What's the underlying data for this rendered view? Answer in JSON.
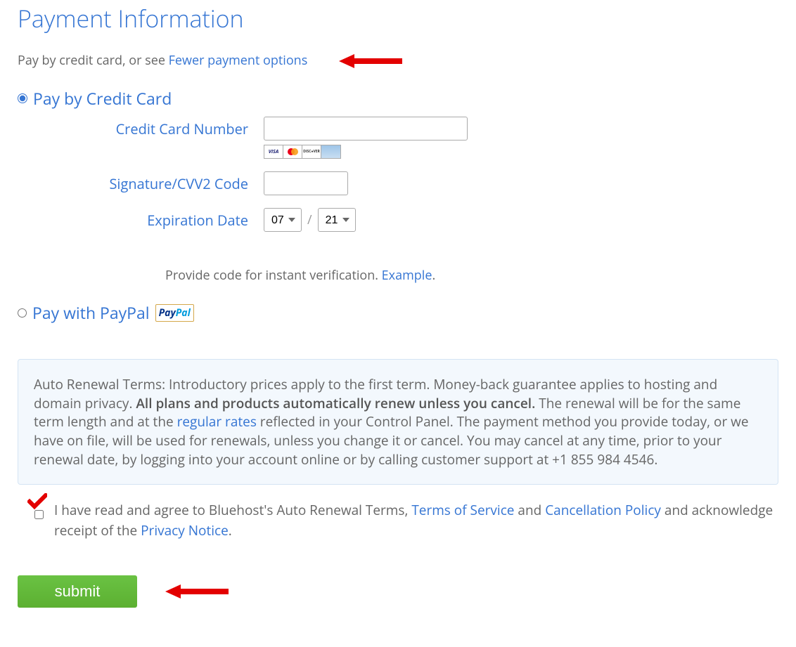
{
  "heading": "Payment Information",
  "intro_prefix": "Pay by credit card, or see ",
  "intro_link": "Fewer payment options",
  "options": {
    "credit": {
      "label": "Pay by Credit Card",
      "cc_label": "Credit Card Number",
      "cvv_label": "Signature/CVV2 Code",
      "exp_label": "Expiration Date",
      "exp_month": "07",
      "exp_year": "21"
    },
    "paypal": {
      "label": "Pay with PayPal"
    }
  },
  "helper_prefix": "Provide code for instant verification. ",
  "helper_link": "Example",
  "helper_suffix": ".",
  "terms": {
    "prefix": "Auto Renewal Terms: Introductory prices apply to the first term. Money-back guarantee applies to hosting and domain privacy. ",
    "bold": "All plans and products automatically renew unless you cancel.",
    "mid1": " The renewal will be for the same term length and at the ",
    "rates_link": "regular rates",
    "mid2": " reflected in your Control Panel. The payment method you provide today, or we have on file, will be used for renewals, unless you change it or cancel. You may cancel at any time, prior to your renewal date, by logging into your account online or by calling customer support at +1 855 984 4546."
  },
  "agree": {
    "prefix": "I have read and agree to Bluehost's Auto Renewal Terms, ",
    "tos": "Terms of Service",
    "and1": " and ",
    "cancel": "Cancellation Policy",
    "mid": " and acknowledge receipt of the ",
    "privacy": "Privacy Notice",
    "suffix": "."
  },
  "submit_label": "submit"
}
